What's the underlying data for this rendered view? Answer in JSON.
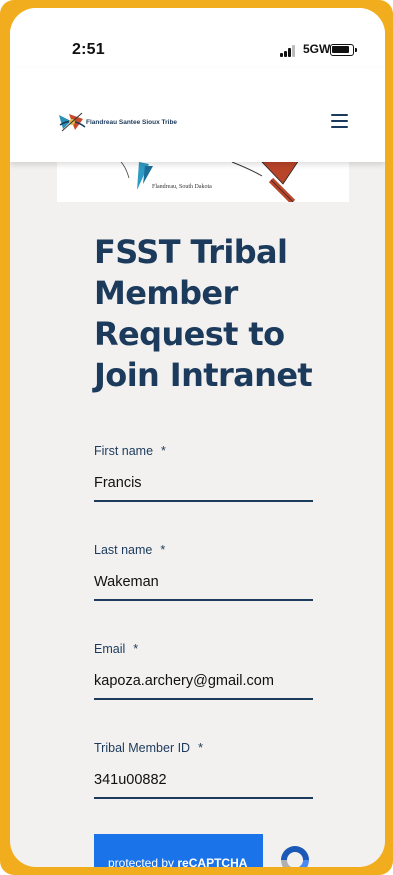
{
  "status_bar": {
    "time": "2:51",
    "network": "5GW"
  },
  "header": {
    "brand": "Flandreau Santee Sioux Tribe",
    "menu_icon": "hamburger-menu-icon"
  },
  "hero": {
    "caption": "Flandreau, South Dakota"
  },
  "page": {
    "title": "FSST Tribal Member Request to Join Intranet"
  },
  "form": {
    "fields": [
      {
        "label": "First name",
        "required_mark": "*",
        "value": "Francis"
      },
      {
        "label": "Last name",
        "required_mark": "*",
        "value": "Wakeman"
      },
      {
        "label": "Email",
        "required_mark": "*",
        "value": "kapoza.archery@gmail.com"
      },
      {
        "label": "Tribal Member ID",
        "required_mark": "*",
        "value": "341u00882"
      }
    ],
    "recaptcha": {
      "prefix": "protected by",
      "brand": "reCAPTCHA"
    }
  },
  "colors": {
    "frame": "#f2ad1e",
    "primary": "#1c3a5c",
    "recaptcha": "#1a73e8"
  }
}
